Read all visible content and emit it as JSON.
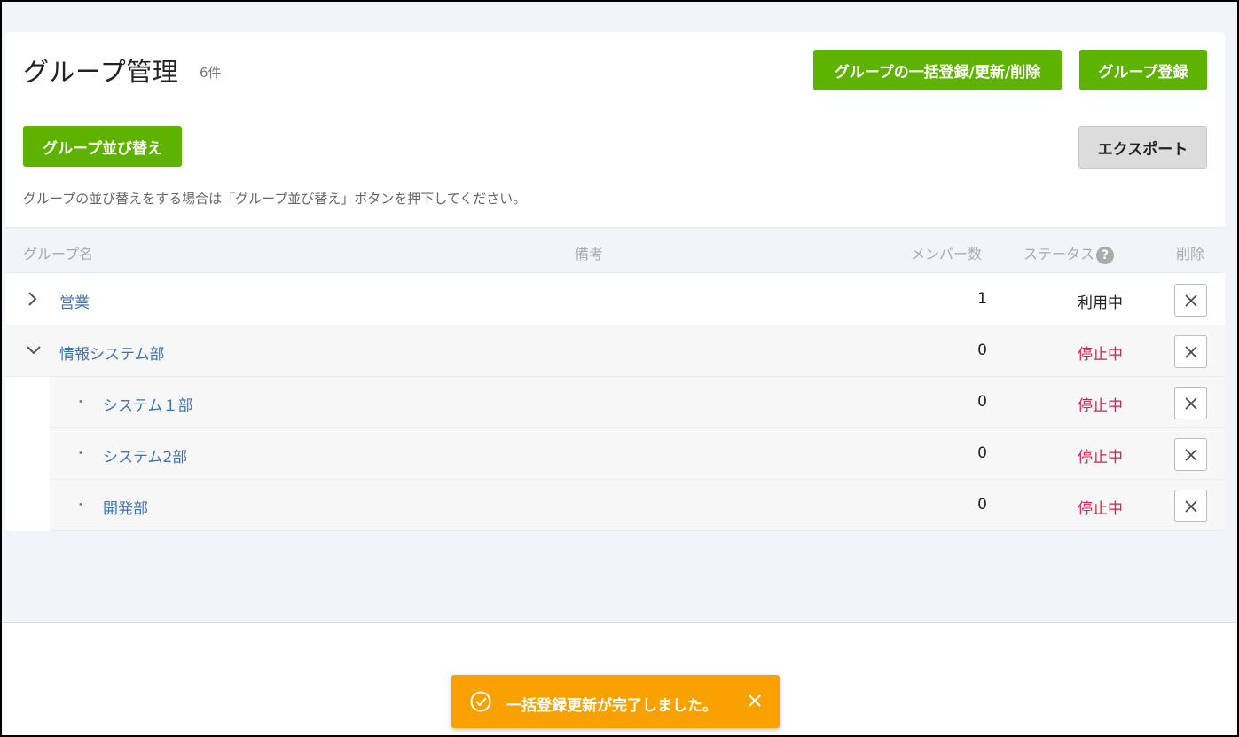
{
  "header": {
    "title": "グループ管理",
    "count": "6件",
    "bulk_button": "グループの一括登録/更新/削除",
    "register_button": "グループ登録"
  },
  "toolbar": {
    "sort_button": "グループ並び替え",
    "export_button": "エクスポート",
    "hint": "グループの並び替えをする場合は「グループ並び替え」ボタンを押下してください。"
  },
  "table": {
    "columns": {
      "name": "グループ名",
      "note": "備考",
      "members": "メンバー数",
      "status": "ステータス",
      "status_help": "?",
      "delete": "削除"
    },
    "rows": [
      {
        "name": "営業",
        "note": "",
        "members": "1",
        "status": "利用中",
        "level": 0,
        "expander": "chevron-right-icon"
      },
      {
        "name": "情報システム部",
        "note": "",
        "members": "0",
        "status": "停止中",
        "level": 0,
        "expander": "chevron-down-icon"
      },
      {
        "name": "システム１部",
        "note": "",
        "members": "0",
        "status": "停止中",
        "level": 1,
        "bullet": "・"
      },
      {
        "name": "システム2部",
        "note": "",
        "members": "0",
        "status": "停止中",
        "level": 1,
        "bullet": "・"
      },
      {
        "name": "開発部",
        "note": "",
        "members": "0",
        "status": "停止中",
        "level": 1,
        "bullet": "・"
      }
    ]
  },
  "toast": {
    "message": "一括登録更新が完了しました。",
    "icon": "check-circle-icon",
    "close_icon": "close-icon"
  },
  "colors": {
    "accent_green": "#5db300",
    "link_blue": "#3b73b9",
    "stopped_red": "#d6204f",
    "toast_orange": "#f8a100",
    "page_bg": "#f1f5fa"
  }
}
